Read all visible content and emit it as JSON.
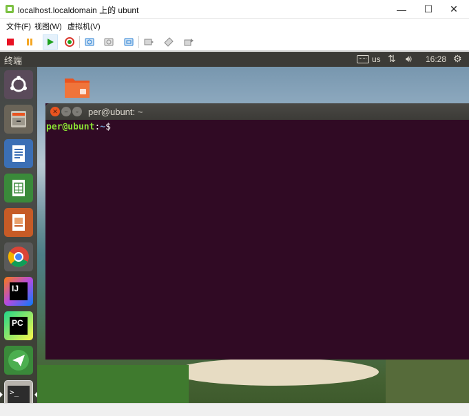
{
  "window": {
    "title": "localhost.localdomain 上的 ubunt",
    "controls": {
      "minimize": "—",
      "maximize": "☐",
      "close": "✕"
    }
  },
  "menu": [
    {
      "label": "文件(F)"
    },
    {
      "label": "视图(W)"
    },
    {
      "label": "虚拟机(V)"
    }
  ],
  "toolbar": [
    {
      "name": "stop",
      "icon": "stop-icon",
      "color": "#e81123"
    },
    {
      "name": "pause",
      "icon": "pause-icon",
      "color": "#f5a623"
    },
    {
      "name": "play",
      "icon": "play-icon",
      "color": "#1ea11e"
    },
    {
      "name": "reset",
      "icon": "refresh-icon",
      "color": "#d9362b"
    },
    {
      "name": "snapshot",
      "icon": "snapshot-icon",
      "color": "#2a7fd4"
    },
    {
      "name": "snapshot-revert",
      "icon": "snapshot-revert-icon",
      "color": "#8a8a8a"
    },
    {
      "name": "snapshot-manager",
      "icon": "snapshot-manager-icon",
      "color": "#2a7fd4"
    },
    {
      "name": "removable-devices",
      "icon": "usb-icon",
      "color": "#8a8a8a"
    },
    {
      "name": "shared-folders",
      "icon": "shared-folders-icon",
      "color": "#8a8a8a"
    },
    {
      "name": "settings",
      "icon": "vm-settings-icon",
      "color": "#8a8a8a"
    }
  ],
  "guest": {
    "panel_title": "终端",
    "keyboard_layout": "us",
    "clock": "16:28",
    "launcher": [
      {
        "name": "ubuntu-dash",
        "icon": "ubuntu-logo-icon"
      },
      {
        "name": "files",
        "icon": "file-cabinet-icon"
      },
      {
        "name": "libreoffice-writer",
        "icon": "writer-icon"
      },
      {
        "name": "libreoffice-calc",
        "icon": "calc-icon"
      },
      {
        "name": "libreoffice-impress",
        "icon": "impress-icon"
      },
      {
        "name": "chrome",
        "icon": "chrome-icon"
      },
      {
        "name": "intellij",
        "icon": "intellij-icon",
        "label": "IJ"
      },
      {
        "name": "pycharm",
        "icon": "pycharm-icon",
        "label": "PC"
      },
      {
        "name": "telegram",
        "icon": "paper-plane-icon"
      },
      {
        "name": "terminal",
        "icon": "terminal-icon",
        "label": ">_"
      }
    ],
    "desktop_icon": "home-folder-icon",
    "terminal": {
      "title": "per@ubunt: ~",
      "prompt_user": "per@ubunt",
      "prompt_colon": ":",
      "prompt_path": "~",
      "prompt_symbol": "$",
      "colors": {
        "background": "#300a24",
        "user": "#8ae234",
        "path": "#729fcf"
      }
    }
  },
  "colors": {
    "ubuntu_orange": "#e95420",
    "panel": "#3c3b37"
  }
}
